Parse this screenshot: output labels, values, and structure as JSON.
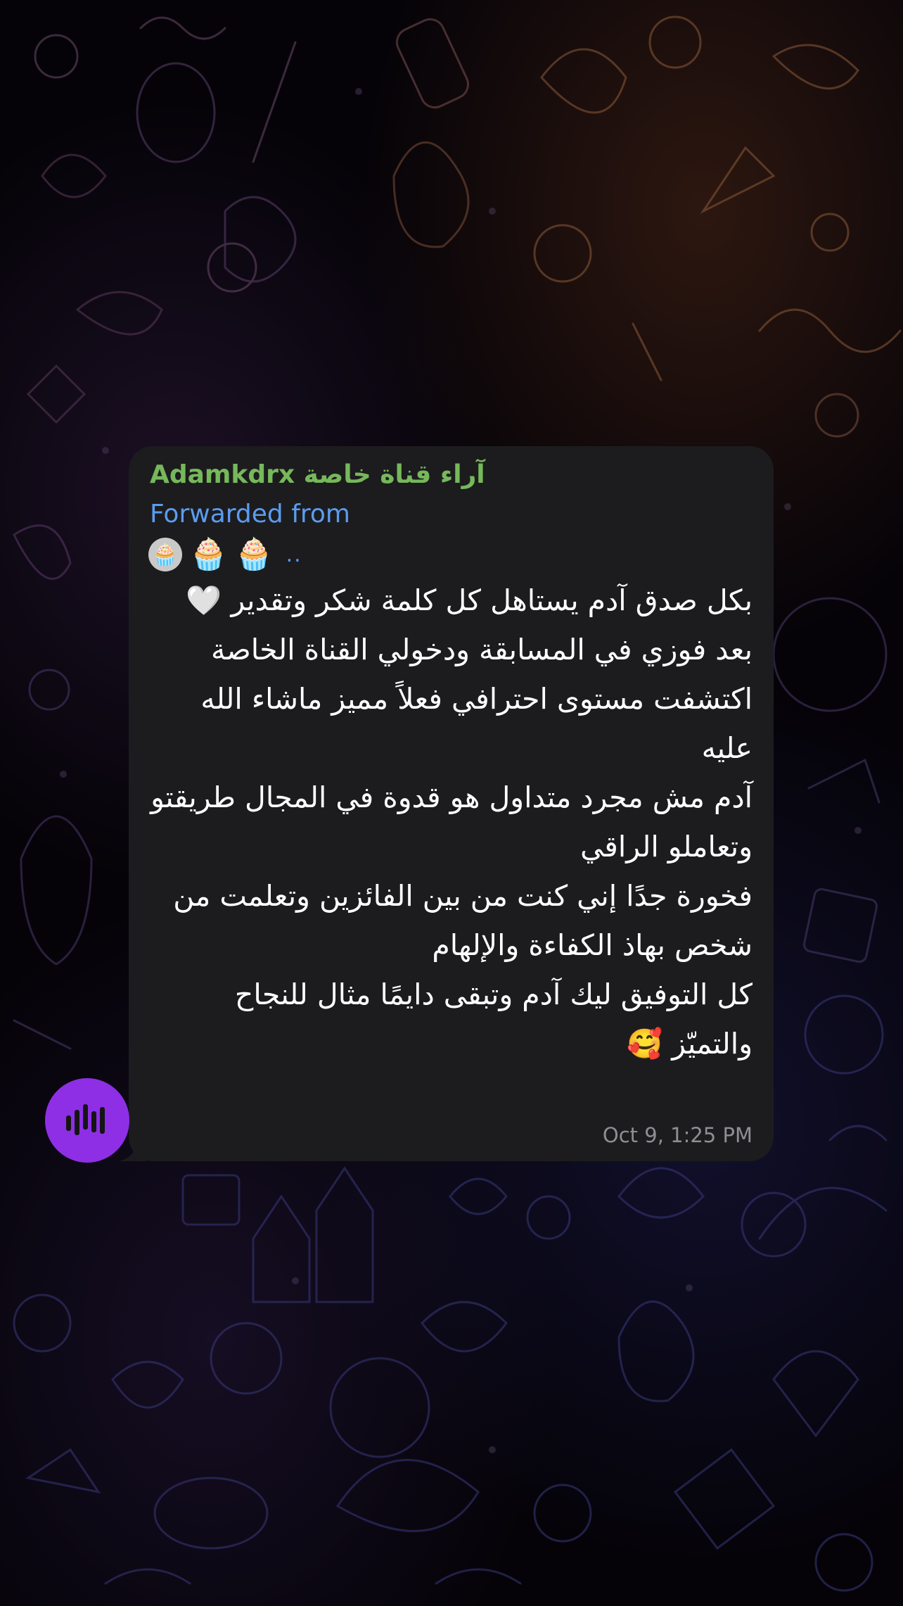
{
  "message": {
    "channel_name": "Adamkdrx آراء قناة خاصة",
    "forwarded_label": "Forwarded from",
    "forwarded_emojis": [
      "🧁",
      "🧁",
      "🧁"
    ],
    "forwarded_more": "..",
    "text": "بكل صدق آدم يستاهل كل كلمة شكر وتقدير 🤍\nبعد فوزي في المسابقة ودخولي القناة الخاصة اكتشفت مستوى احترافي فعلاً مميز ماشاء الله عليه\nآدم مش مجرد متداول هو قدوة في المجال طريقتو وتعاملو الراقي\nفخورة جدًا إني كنت من بين الفائزين وتعلمت من شخص بهاذ الكفاءة والإلهام\nكل التوفيق ليك آدم وتبقى دايمًا مثال للنجاح والتميّز 🥰",
    "timestamp": "Oct 9, 1:25 PM"
  },
  "sender": {
    "avatar_icon": "waveform-icon"
  },
  "colors": {
    "bubble": "#1c1c1e",
    "channel_name": "#76b85a",
    "forwarded": "#5b9cf0",
    "timestamp": "#8e8e93",
    "avatar": "#8e2fe6"
  }
}
